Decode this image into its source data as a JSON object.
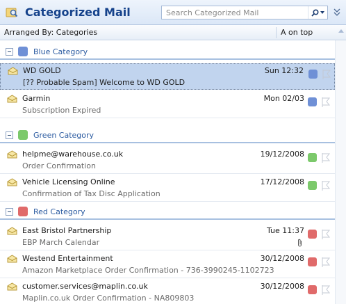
{
  "header": {
    "title": "Categorized Mail",
    "search_placeholder": "Search Categorized Mail"
  },
  "arrange": {
    "label": "Arranged By: Categories",
    "sort": "A on top"
  },
  "groups": [
    {
      "name": "Blue Category",
      "color": "#6f90d6",
      "items": [
        {
          "sender": "WD GOLD",
          "subject": "[?? Probable Spam]  Welcome to WD GOLD",
          "date": "Sun 12:32",
          "selected": true,
          "attachment": false
        },
        {
          "sender": "Garmin",
          "subject": "Subscription Expired",
          "date": "Mon 02/03",
          "selected": false,
          "attachment": false
        }
      ]
    },
    {
      "name": "Green Category",
      "color": "#7cc96b",
      "items": [
        {
          "sender": "helpme@warehouse.co.uk",
          "subject": "Order Confirmation",
          "date": "19/12/2008",
          "selected": false,
          "attachment": false
        },
        {
          "sender": "Vehicle Licensing Online",
          "subject": "Confirmation of Tax Disc Application",
          "date": "17/12/2008",
          "selected": false,
          "attachment": false
        }
      ]
    },
    {
      "name": "Red Category",
      "color": "#e06a6a",
      "items": [
        {
          "sender": "East Bristol Partnership",
          "subject": "EBP March Calendar",
          "date": "Tue 11:37",
          "selected": false,
          "attachment": true
        },
        {
          "sender": "Westend Entertainment",
          "subject": "Amazon Marketplace Order Confirmation - 736-3990245-1102723",
          "date": "30/12/2008",
          "selected": false,
          "attachment": false
        },
        {
          "sender": "customer.services@maplin.co.uk",
          "subject": "Maplin.co.uk Order Confirmation - NA809803",
          "date": "30/12/2008",
          "selected": false,
          "attachment": false
        }
      ]
    }
  ]
}
